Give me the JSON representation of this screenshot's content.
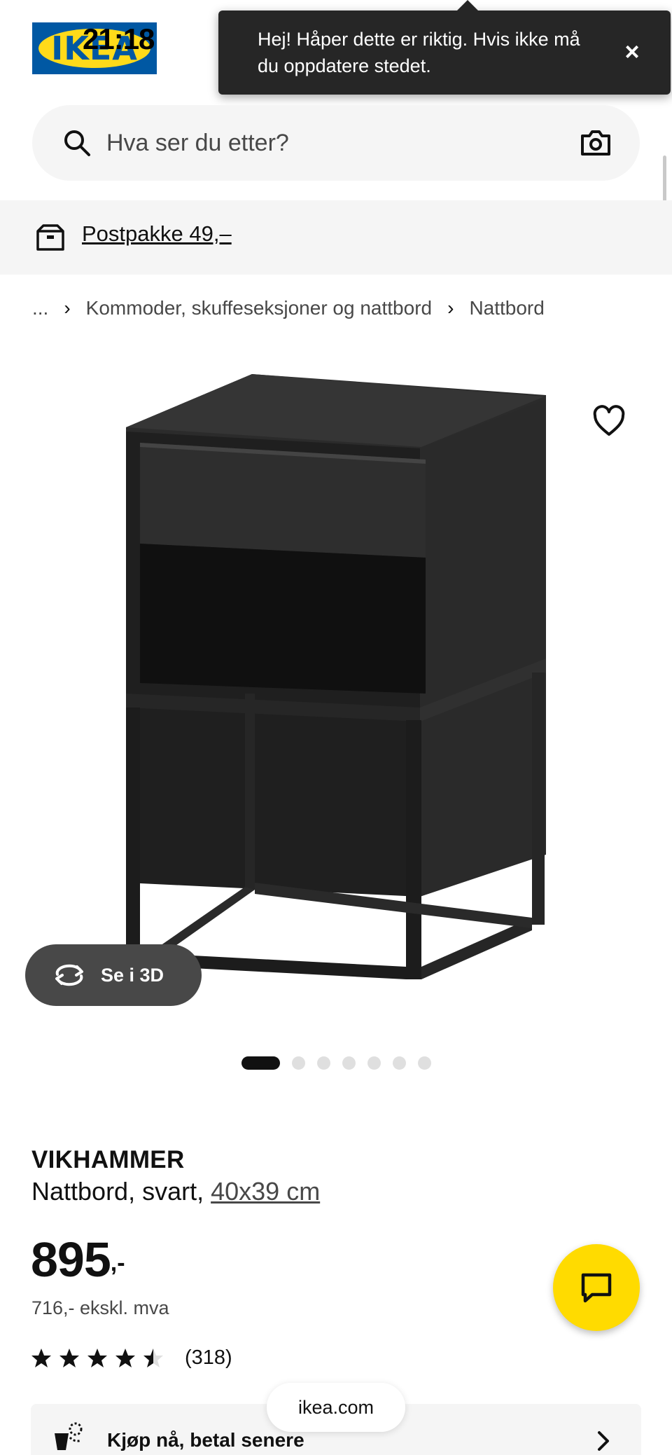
{
  "status_bar": {
    "time": "21:18"
  },
  "header": {
    "logo_text": "IKEA"
  },
  "toast": {
    "message": "Hej! Håper dette er riktig. Hvis ikke må du oppdatere stedet."
  },
  "search": {
    "placeholder": "Hva ser du etter?"
  },
  "delivery": {
    "label": "Postpakke 49,–"
  },
  "breadcrumb": {
    "items": [
      "...",
      "Kommoder, skuffeseksjoner og nattbord",
      "Nattbord"
    ]
  },
  "gallery": {
    "view_3d_label": "Se i 3D",
    "image_count": 7,
    "active_index": 0
  },
  "product": {
    "name": "VIKHAMMER",
    "description": "Nattbord, svart,",
    "size": "40x39 cm",
    "price_integer": "895",
    "price_suffix": ",-",
    "price_ex_vat": "716,- ekskl. mva",
    "rating": 4.5,
    "review_count": "(318)"
  },
  "payment": {
    "label": "Kjøp nå, betal senere"
  },
  "browser": {
    "url": "ikea.com"
  },
  "colors": {
    "brand_blue": "#0058a3",
    "brand_yellow": "#ffda1a",
    "chat_yellow": "#ffdb00",
    "text": "#111111"
  }
}
